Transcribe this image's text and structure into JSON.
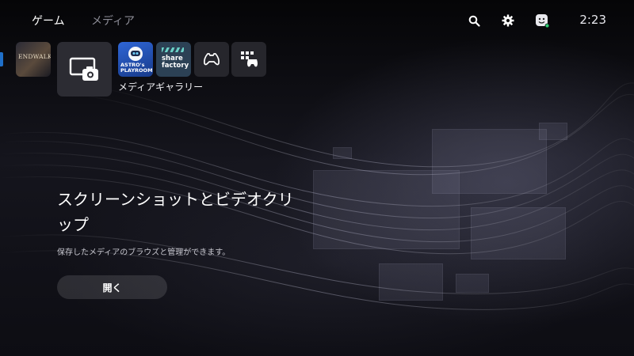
{
  "header": {
    "tabs": [
      {
        "label": "ゲーム",
        "active": true
      },
      {
        "label": "メディア",
        "active": false
      }
    ],
    "icons": [
      "search-icon",
      "gear-icon",
      "profile-avatar-icon"
    ],
    "status_dot_color": "#2ecc71",
    "clock": "2:23"
  },
  "tiles": {
    "ff_logo_text": "ENDWALKER",
    "astro_logo_text": "ASTRO's PLAYROOM",
    "share_logo_text": "share factory",
    "selected_label": "メディアギャラリー"
  },
  "main": {
    "title": "スクリーンショットとビデオクリップ",
    "description": "保存したメディアのブラウズと管理ができます。",
    "open_button": "開く"
  },
  "colors": {
    "background": "#0b0b10",
    "accent_blue": "#1f6fc9"
  }
}
